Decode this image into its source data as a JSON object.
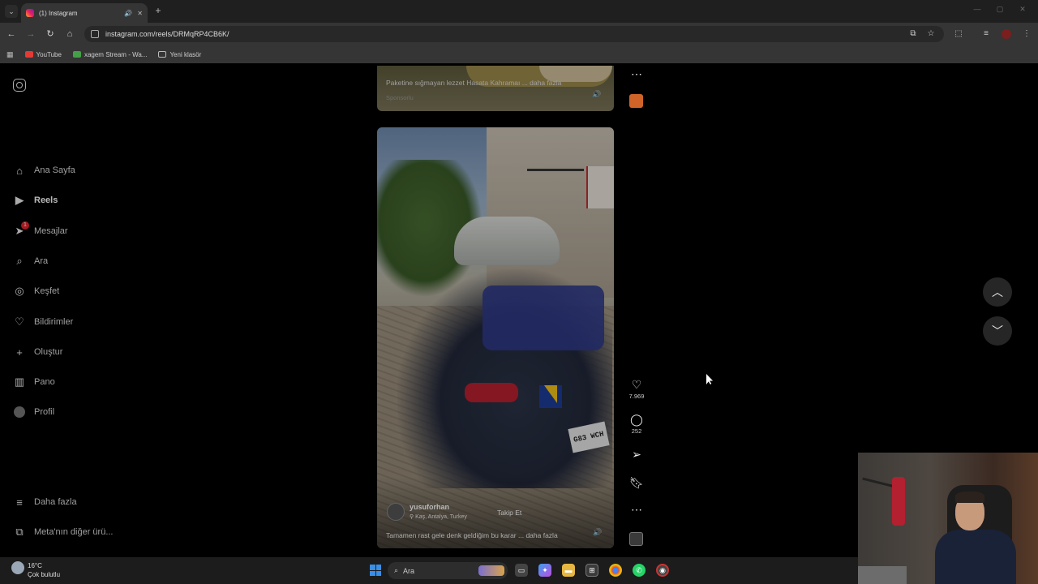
{
  "browser": {
    "tab_title": "(1) Instagram",
    "new_tab_icon": "plus-icon",
    "url": "instagram.com/reels/DRMqRP4CB6K/",
    "bookmarks": [
      {
        "label": "YouTube",
        "color": "#e53935"
      },
      {
        "label": "xagem Stream - Wa...",
        "color": "#43a047"
      },
      {
        "label": "Yeni klasör",
        "color": "#9e9e9e"
      }
    ]
  },
  "sidebar": {
    "items": [
      {
        "label": "Ana Sayfa",
        "icon": "home-icon"
      },
      {
        "label": "Reels",
        "icon": "reels-icon"
      },
      {
        "label": "Mesajlar",
        "icon": "messages-icon",
        "badge": "1"
      },
      {
        "label": "Ara",
        "icon": "search-icon"
      },
      {
        "label": "Keşfet",
        "icon": "explore-icon"
      },
      {
        "label": "Bildirimler",
        "icon": "heart-icon"
      },
      {
        "label": "Oluştur",
        "icon": "plus-icon"
      },
      {
        "label": "Pano",
        "icon": "dashboard-icon"
      },
      {
        "label": "Profil",
        "icon": "avatar-icon"
      }
    ],
    "more": "Daha fazla",
    "meta": "Meta'nın diğer ürü..."
  },
  "prev_reel": {
    "caption": "Paketine sığmayan lezzet Hasata Kahramaı ... daha fazla",
    "sponsored": "Sponsorlu"
  },
  "reel": {
    "username": "yusuforhan",
    "location": "Kaş, Antalya, Turkey",
    "follow": "Takip Et",
    "caption": "Tamamen rast gele denk geldiğim bu karar ... daha fazla",
    "plate": "G83 WCH",
    "likes": "7.969",
    "comments": "252"
  },
  "taskbar": {
    "temperature": "16°C",
    "weather": "Çok bulutlu",
    "search_placeholder": "Ara"
  },
  "colors": {
    "accent_badge": "#e0242f",
    "background": "#000000"
  }
}
